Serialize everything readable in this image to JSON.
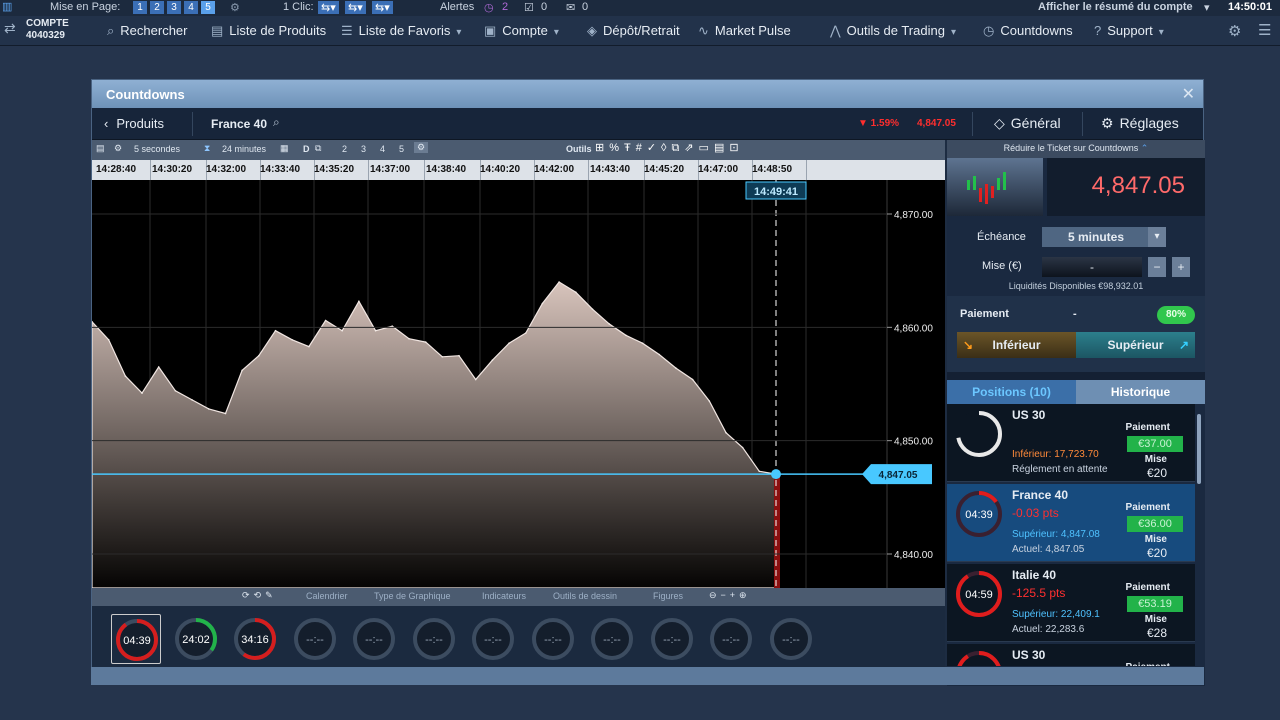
{
  "topbar": {
    "mise_label": "Mise en Page:",
    "pages": [
      "1",
      "2",
      "3",
      "4",
      "5"
    ],
    "clic_label": "1 Clic:",
    "alerts_label": "Alertes",
    "alerts_count": "2",
    "count_a": "0",
    "count_b": "0",
    "summary_link": "Afficher le résumé du compte",
    "time": "14:50:01"
  },
  "account": {
    "label": "COMPTE",
    "number": "4040329"
  },
  "nav": {
    "items": [
      {
        "label": "Rechercher",
        "icon": "search-icon"
      },
      {
        "label": "Liste de Produits",
        "icon": "list-icon"
      },
      {
        "label": "Liste de Favoris",
        "icon": "star-list-icon"
      },
      {
        "label": "Compte",
        "icon": "account-icon"
      },
      {
        "label": "Dépôt/Retrait",
        "icon": "deposit-icon"
      },
      {
        "label": "Market Pulse",
        "icon": "pulse-icon"
      },
      {
        "label": "Outils de Trading",
        "icon": "tools-icon"
      },
      {
        "label": "Countdowns",
        "icon": "clock-icon"
      },
      {
        "label": "Support",
        "icon": "help-icon"
      }
    ]
  },
  "window": {
    "title": "Countdowns"
  },
  "subheader": {
    "back_label": "Produits",
    "instrument": "France 40",
    "change": "▼ 1.59%",
    "price": "4,847.05",
    "general": "Général",
    "settings": "Réglages"
  },
  "toolbar": {
    "interval": "5 secondes",
    "range": "24 minutes",
    "tools_label": "Outils",
    "slots": [
      "2",
      "3",
      "4",
      "5"
    ]
  },
  "time_axis": [
    "14:28:40",
    "14:30:20",
    "14:32:00",
    "14:33:40",
    "14:35:20",
    "14:37:00",
    "14:38:40",
    "14:40:20",
    "14:42:00",
    "14:43:40",
    "14:45:20",
    "14:47:00",
    "14:48:50"
  ],
  "chart_data": {
    "type": "area",
    "current_time": "14:49:41",
    "current_price": "4,847.05",
    "y_ticks": [
      "4,870.00",
      "4,860.00",
      "4,850.00",
      "4,840.00"
    ],
    "ylim": [
      4837,
      4873
    ],
    "values": [
      4860.5,
      4858.9,
      4855.7,
      4854.2,
      4856.5,
      4854.4,
      4853.6,
      4852.8,
      4852.4,
      4856.2,
      4857.5,
      4859.7,
      4858.9,
      4858.3,
      4860.6,
      4859.7,
      4862.3,
      4859.7,
      4860.1,
      4859.0,
      4858.7,
      4857.4,
      4857.5,
      4855.4,
      4857.1,
      4858.6,
      4859.5,
      4862.1,
      4864.0,
      4863.1,
      4861.6,
      4860.3,
      4859.3,
      4858.6,
      4857.6,
      4856.4,
      4855.4,
      4853.5,
      4850.7,
      4849.4,
      4847.3,
      4847.05
    ]
  },
  "bottom_tabs": [
    "Calendrier",
    "Type de Graphique",
    "Indicateurs",
    "Outils de dessin",
    "Figures"
  ],
  "timers": [
    "04:39",
    "24:02",
    "34:16",
    "--:--",
    "--:--",
    "--:--",
    "--:--",
    "--:--",
    "--:--",
    "--:--",
    "--:--",
    "--:--"
  ],
  "ticket": {
    "reduce_label": "Réduire le Ticket sur Countdowns",
    "price": "4,847.05",
    "expiry_label": "Échéance",
    "expiry_value": "5 minutes",
    "stake_label": "Mise (€)",
    "stake_value": "-",
    "liquidity": "Liquidités Disponibles €98,932.01",
    "payout_label": "Paiement",
    "payout_value": "-",
    "payout_pct": "80%",
    "lower": "Inférieur",
    "higher": "Supérieur"
  },
  "tabs": {
    "positions": "Positions (10)",
    "history": "Historique"
  },
  "positions": [
    {
      "name": "US 30",
      "timer": "",
      "pts": "",
      "line1": "Inférieur: 17,723.70",
      "line2": "Réglement en attente",
      "pay_label": "Paiement",
      "pay": "€37.00",
      "stake_label": "Mise",
      "stake": "€20"
    },
    {
      "name": "France 40",
      "timer": "04:39",
      "pts": "-0.03 pts",
      "line1": "Supérieur: 4,847.08",
      "line2": "Actuel: 4,847.05",
      "pay_label": "Paiement",
      "pay": "€36.00",
      "stake_label": "Mise",
      "stake": "€20"
    },
    {
      "name": "Italie 40",
      "timer": "04:59",
      "pts": "-125.5 pts",
      "line1": "Supérieur: 22,409.1",
      "line2": "Actuel: 22,283.6",
      "pay_label": "Paiement",
      "pay": "€53.19",
      "stake_label": "Mise",
      "stake": "€28"
    },
    {
      "name": "US 30",
      "timer": "",
      "pts": "",
      "line1": "",
      "line2": "",
      "pay_label": "Paiement",
      "pay": "",
      "stake_label": "",
      "stake": ""
    }
  ]
}
